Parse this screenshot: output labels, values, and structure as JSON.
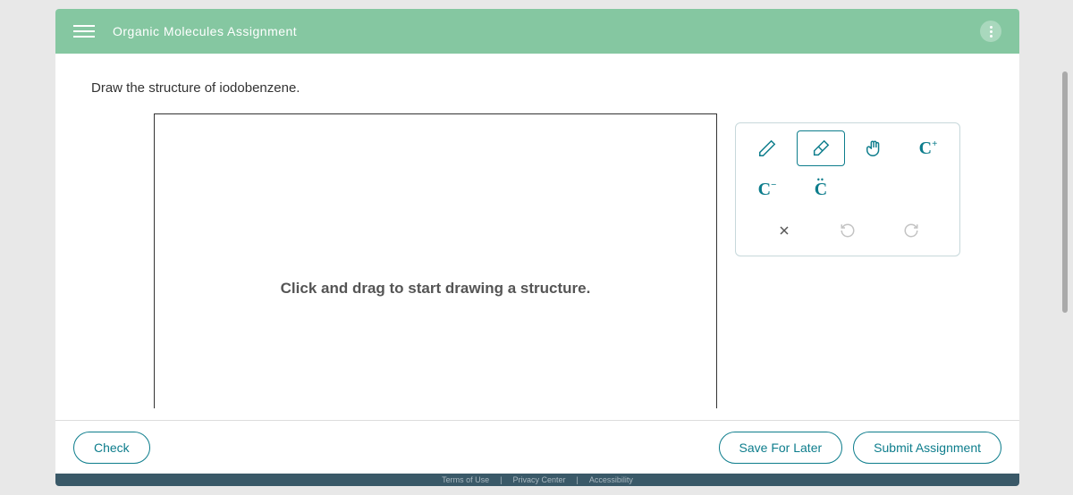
{
  "header": {
    "title": "Organic Molecules Assignment"
  },
  "prompt": "Draw the structure of iodobenzene.",
  "canvas": {
    "placeholder": "Click and drag to start drawing a structure."
  },
  "tools": {
    "pencil": "pencil-icon",
    "eraser": "eraser-icon",
    "move": "hand-icon",
    "c_plus": "C",
    "c_plus_sup": "+",
    "c_minus": "C",
    "c_minus_sup": "−",
    "c_radical": "C",
    "close": "×",
    "undo": "undo-icon",
    "redo": "redo-icon"
  },
  "buttons": {
    "check": "Check",
    "save": "Save For Later",
    "submit": "Submit Assignment"
  },
  "legal": {
    "terms": "Terms of Use",
    "privacy": "Privacy Center",
    "accessibility": "Accessibility"
  }
}
